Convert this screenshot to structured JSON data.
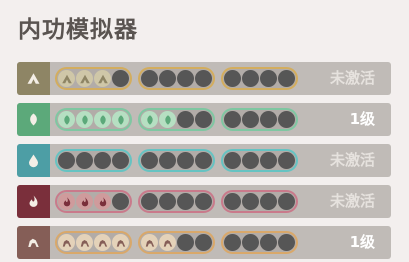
{
  "title": "内功模拟器",
  "rows": [
    {
      "element": "earth",
      "icon": "mountain-icon",
      "icon_bg": "#8e8565",
      "group_border": "#d3ad5e",
      "active_fill": "#cfc7a8",
      "status": "未激活",
      "status_color": "#e6e2de",
      "groups": [
        3,
        0,
        0
      ]
    },
    {
      "element": "wood",
      "icon": "leaf-icon",
      "icon_bg": "#5ca97a",
      "group_border": "#7fc7a2",
      "active_fill": "#b6dfc2",
      "status": "1级",
      "status_color": "#ffffff",
      "groups": [
        4,
        2,
        0
      ]
    },
    {
      "element": "water",
      "icon": "water-drop-icon",
      "icon_bg": "#4d9ea5",
      "group_border": "#66c3c2",
      "active_fill": "#a9dbe0",
      "status": "未激活",
      "status_color": "#e6e2de",
      "groups": [
        0,
        0,
        0
      ]
    },
    {
      "element": "fire",
      "icon": "flame-icon",
      "icon_bg": "#7a2f3b",
      "group_border": "#c97a8b",
      "active_fill": "#cf9b9c",
      "status": "未激活",
      "status_color": "#e6e2de",
      "groups": [
        3,
        0,
        0
      ]
    },
    {
      "element": "metal",
      "icon": "ore-icon",
      "icon_bg": "#855e57",
      "group_border": "#d9a86a",
      "active_fill": "#e4d2b9",
      "status": "1级",
      "status_color": "#ffffff",
      "groups": [
        4,
        2,
        0
      ]
    }
  ]
}
